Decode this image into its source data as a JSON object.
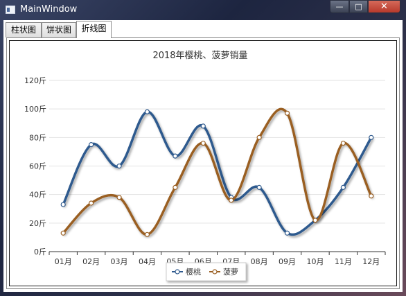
{
  "window": {
    "title": "MainWindow",
    "controls": {
      "minimize": "—",
      "maximize": "□",
      "close": "✕"
    }
  },
  "tabs": [
    {
      "label": "柱状图",
      "active": false
    },
    {
      "label": "饼状图",
      "active": false
    },
    {
      "label": "折线图",
      "active": true
    }
  ],
  "chart_data": {
    "type": "line",
    "smooth": true,
    "title": "2018年樱桃、菠萝销量",
    "categories": [
      "01月",
      "02月",
      "03月",
      "04月",
      "05月",
      "06月",
      "07月",
      "08月",
      "09月",
      "10月",
      "11月",
      "12月"
    ],
    "y_ticks": [
      "0斤",
      "20斤",
      "40斤",
      "60斤",
      "80斤",
      "100斤",
      "120斤"
    ],
    "ylim": [
      0,
      120
    ],
    "grid": true,
    "legend_position": "bottom",
    "series": [
      {
        "name": "樱桃",
        "color": "#2f5a8e",
        "values": [
          33,
          75,
          60,
          98,
          67,
          88,
          38,
          45,
          13,
          22,
          45,
          80
        ]
      },
      {
        "name": "菠萝",
        "color": "#9a5f22",
        "values": [
          13,
          34,
          38,
          12,
          45,
          76,
          36,
          80,
          97,
          22,
          76,
          39
        ]
      }
    ]
  }
}
